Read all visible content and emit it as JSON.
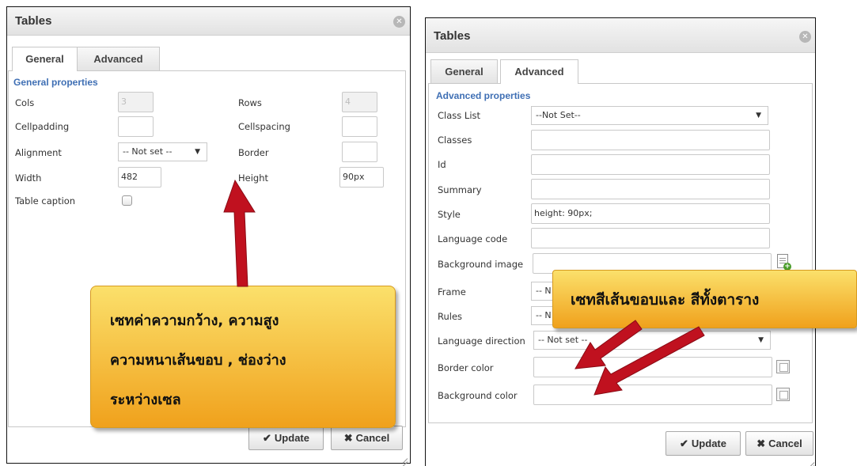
{
  "left_dialog": {
    "title": "Tables",
    "tabs": [
      {
        "label": "General",
        "active": true
      },
      {
        "label": "Advanced",
        "active": false
      }
    ],
    "section_label": "General properties",
    "fields": {
      "cols": {
        "label": "Cols",
        "value": "3",
        "disabled": true
      },
      "rows": {
        "label": "Rows",
        "value": "4",
        "disabled": true
      },
      "cellpadding": {
        "label": "Cellpadding",
        "value": ""
      },
      "cellspacing": {
        "label": "Cellspacing",
        "value": ""
      },
      "alignment": {
        "label": "Alignment",
        "value": "-- Not set --"
      },
      "border": {
        "label": "Border",
        "value": ""
      },
      "width": {
        "label": "Width",
        "value": "482"
      },
      "height": {
        "label": "Height",
        "value": "90px"
      },
      "table_caption": {
        "label": "Table caption",
        "checked": false
      }
    },
    "buttons": {
      "update": "Update",
      "cancel": "Cancel"
    }
  },
  "right_dialog": {
    "title": "Tables",
    "tabs": [
      {
        "label": "General",
        "active": false
      },
      {
        "label": "Advanced",
        "active": true
      }
    ],
    "section_label": "Advanced properties",
    "fields": {
      "class_list": {
        "label": "Class List",
        "value": "--Not Set--"
      },
      "classes": {
        "label": "Classes",
        "value": ""
      },
      "id": {
        "label": "Id",
        "value": ""
      },
      "summary": {
        "label": "Summary",
        "value": ""
      },
      "style": {
        "label": "Style",
        "value": "height: 90px;"
      },
      "language_code": {
        "label": "Language code",
        "value": ""
      },
      "background_image": {
        "label": "Background image",
        "value": ""
      },
      "frame": {
        "label": "Frame",
        "value": "-- N"
      },
      "rules": {
        "label": "Rules",
        "value": "-- N"
      },
      "language_direction": {
        "label": "Language direction",
        "value": "-- Not set --"
      },
      "border_color": {
        "label": "Border color",
        "value": ""
      },
      "background_color": {
        "label": "Background color",
        "value": ""
      }
    },
    "buttons": {
      "update": "Update",
      "cancel": "Cancel"
    }
  },
  "callouts": {
    "left": [
      "เซทค่าความกว้าง, ความสูง",
      "ความหนาเส้นขอบ , ช่องว่าง",
      "ระหว่างเซล"
    ],
    "right": "เซทสีเส้นขอบและ สีทั้งตาราง"
  },
  "colors": {
    "arrow": "#c0111f",
    "callout_top": "#fbe06b",
    "callout_bottom": "#f0a11c",
    "section_label": "#3f6fb4"
  },
  "icons": {
    "close": "close-icon",
    "check": "check-icon",
    "cancel": "x-icon",
    "dropdown": "chevron-down-icon",
    "color_picker": "color-picker-icon",
    "browse": "browse-image-icon"
  }
}
